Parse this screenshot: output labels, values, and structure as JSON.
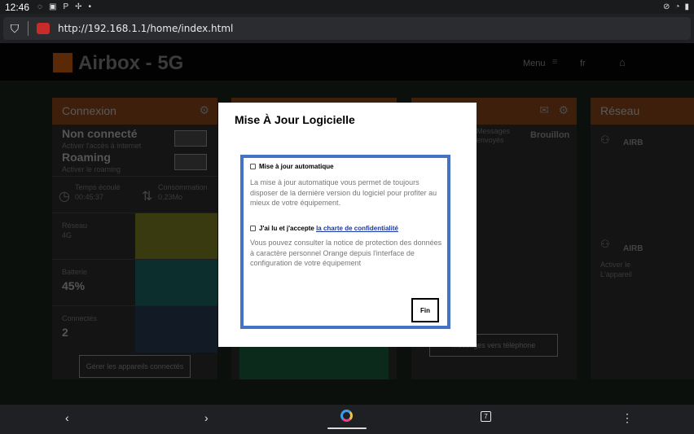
{
  "status_bar": {
    "time": "12:46",
    "left_icons": [
      "wifi-icon",
      "image-icon",
      "p-icon",
      "fan-icon",
      "dot-icon"
    ],
    "right_icons": [
      "mute-icon",
      "wifi-icon",
      "battery-icon"
    ]
  },
  "browser": {
    "url": "http://192.168.1.1/home/index.html"
  },
  "header": {
    "brand": "Airbox - 5G",
    "menu": "Menu",
    "lang": "fr"
  },
  "cards": {
    "connexion": {
      "title": "Connexion",
      "status": "Non connecté",
      "status_sub": "Activer l'accès à internet",
      "roaming": "Roaming",
      "roaming_sub": "Activer le roaming",
      "time_label": "Temps écoulé",
      "time_value": "00:45:37",
      "consumption_label": "Consommation",
      "consumption_value": "0.23Mo",
      "network_label": "Réseau",
      "network_value": "4G",
      "battery_label": "Batterie",
      "battery_value": "45%",
      "connected_label": "Connectés",
      "connected_value": "2",
      "manage_button": "Gérer les appareils connectés"
    },
    "messages": {
      "tab1": "Messages envoyés",
      "tab2": "Brouillon",
      "button": "Messages vers téléphone"
    },
    "reseau": {
      "title": "Réseau",
      "item1": "AIRB",
      "item2": "AIRB",
      "sub2_line1": "Activer le",
      "sub2_line2": "L'appareil"
    }
  },
  "modal": {
    "title": "Mise À Jour Logicielle",
    "option1_label": "Mise à jour automatique",
    "option1_desc": "La mise à jour automatique vous permet de toujours disposer de la dernière version du logiciel pour profiter au mieux de votre équipement.",
    "option2_prefix": "J'ai lu et j'accepte ",
    "option2_link": "la charte de confidentialité",
    "option2_desc": "Vous pouvez consulter la notice de protection des données à caractère personnel Orange depuis l'interface de configuration de votre équipement",
    "button": "Fin"
  },
  "navbar": {
    "tab_count": "7"
  }
}
